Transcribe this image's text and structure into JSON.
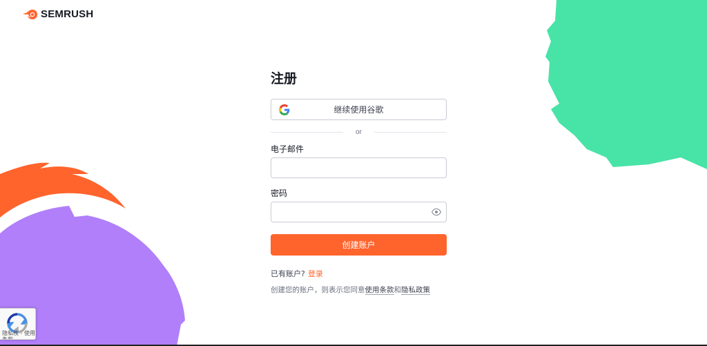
{
  "brand": {
    "name": "SEMRUSH"
  },
  "signup": {
    "title": "注册",
    "google_label": "继续使用谷歌",
    "divider_text": "or",
    "email_label": "电子邮件",
    "email_value": "",
    "password_label": "密码",
    "password_value": "",
    "submit_label": "创建账户"
  },
  "login_prompt": {
    "text": "已有账户?",
    "link": "登录"
  },
  "terms": {
    "prefix": "创建您的账户，则表示您同意",
    "terms_link": "使用条款",
    "and": "和",
    "privacy_link": "隐私政策"
  },
  "recaptcha": {
    "text": "隐私权 - 使用条款"
  },
  "colors": {
    "accent": "#ff642d",
    "green_blob": "#48e3a7",
    "purple_blob": "#b07ff9",
    "orange_decor": "#ff642d"
  },
  "icons": [
    "semrush-logo-icon",
    "google-icon",
    "eye-icon",
    "recaptcha-icon"
  ]
}
